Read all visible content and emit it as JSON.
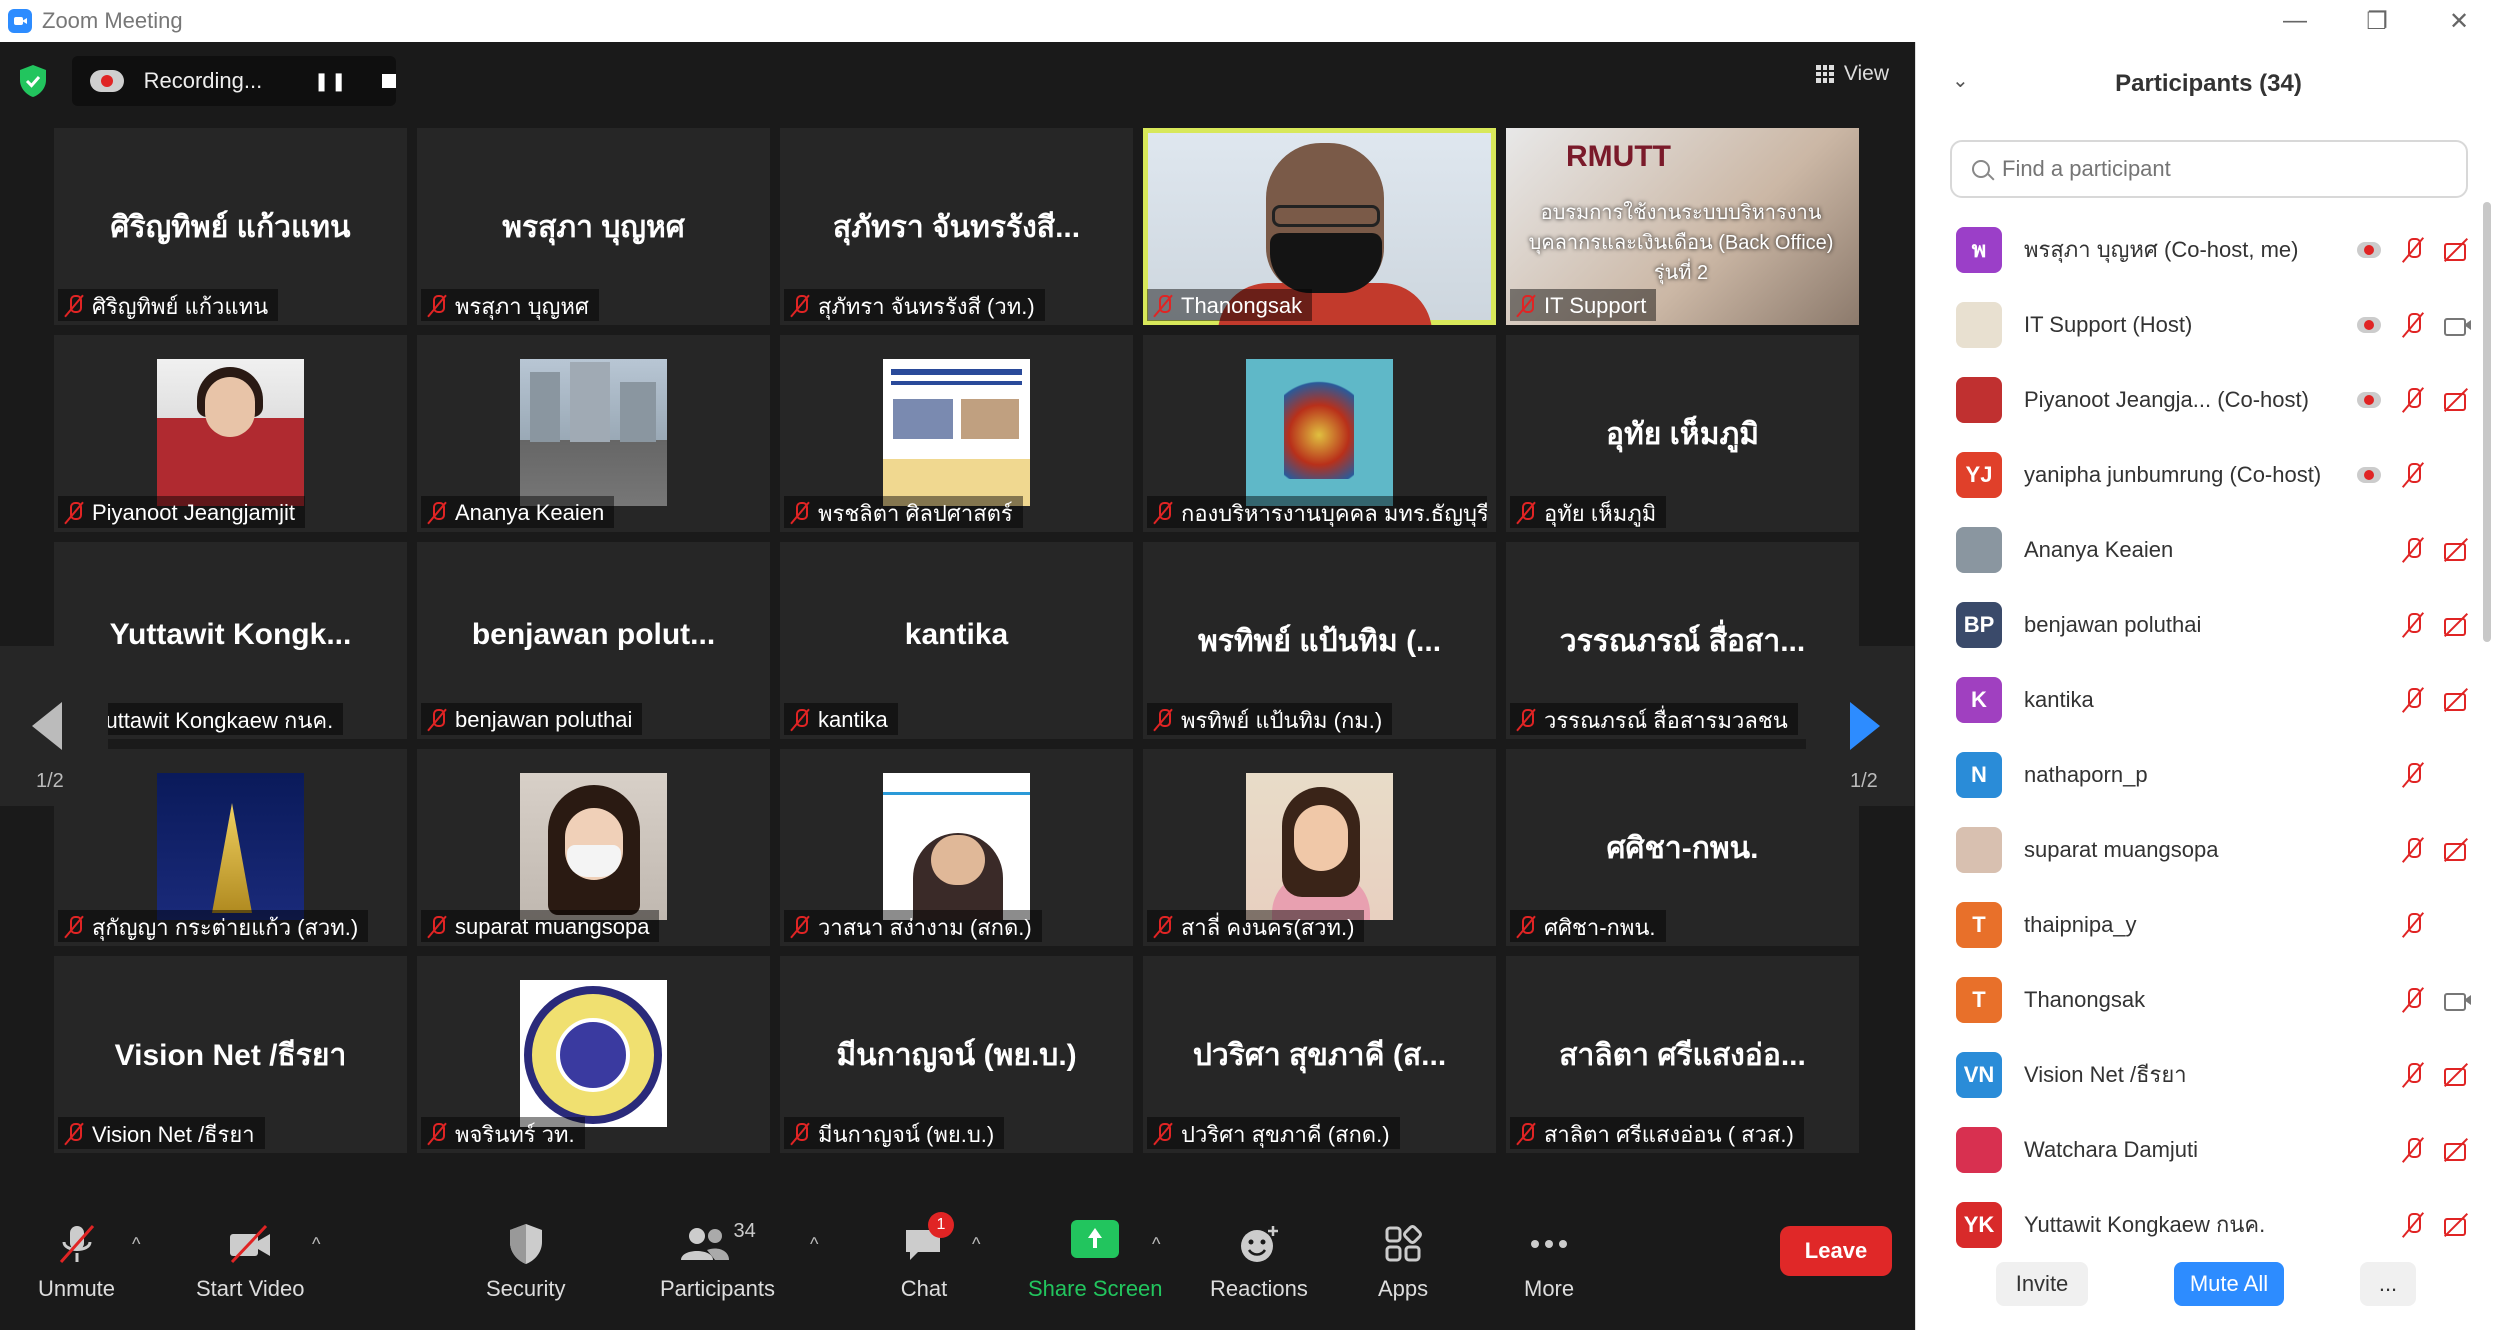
{
  "window": {
    "title": "Zoom Meeting",
    "controls": [
      "—",
      "❐",
      "✕"
    ]
  },
  "topbar": {
    "recording_label": "Recording...",
    "pause_glyph": "❚❚",
    "view_label": "View"
  },
  "tiles": [
    {
      "big": "ศิริญทิพย์ แก้วแทน",
      "label": "ศิริญทิพย์ แก้วแทน"
    },
    {
      "big": "พรสุภา บุญหศ",
      "label": "พรสุภา บุญหศ"
    },
    {
      "big": "สุภัทรา จันทรรังสี...",
      "label": "สุภัทรา จันทรรังสี (วท.)"
    },
    {
      "big": "",
      "label": "Thanongsak"
    },
    {
      "big": "",
      "label": "IT Support",
      "share_title": "RMUTT",
      "share_text": "อบรมการใช้งานระบบบริหารงานบุคลากรและเงินเดือน (Back Office) รุ่นที่ 2"
    },
    {
      "big": "",
      "label": "Piyanoot Jeangjamjit"
    },
    {
      "big": "",
      "label": "Ananya Keaien"
    },
    {
      "big": "",
      "label": "พรชลิตา ศิลปศาสตร์"
    },
    {
      "big": "",
      "label": "กองบริหารงานบุคคล มทร.ธัญบุรี"
    },
    {
      "big": "อุทัย เห็มภูมิ",
      "label": "อุทัย เห็มภูมิ"
    },
    {
      "big": "Yuttawit Kongk...",
      "label": "Yuttawit Kongkaew กนค."
    },
    {
      "big": "benjawan polut...",
      "label": "benjawan poluthai"
    },
    {
      "big": "kantika",
      "label": "kantika"
    },
    {
      "big": "พรทิพย์ แป้นทิม (...",
      "label": "พรทิพย์ แป้นทิม (กม.)"
    },
    {
      "big": "วรรณภรณ์ สื่อสา...",
      "label": "วรรณภรณ์ สื่อสารมวลชน"
    },
    {
      "big": "",
      "label": "สุกัญญา กระต่ายแก้ว (สวท.)"
    },
    {
      "big": "",
      "label": "suparat muangsopa"
    },
    {
      "big": "",
      "label": "วาสนา สง่างาม (สกด.)"
    },
    {
      "big": "",
      "label": "สาลี่ คงนคร(สวท.)"
    },
    {
      "big": "ศศิชา-กพน.",
      "label": "ศศิชา-กพน."
    },
    {
      "big": "Vision Net /ธีรยา",
      "label": "Vision Net /ธีรยา"
    },
    {
      "big": "",
      "label": "พจรินทร์ วท."
    },
    {
      "big": "มีนกาญจน์ (พย.บ.)",
      "label": "มีนกาญจน์ (พย.บ.)"
    },
    {
      "big": "ปวริศา สุขภาคี (ส...",
      "label": "ปวริศา สุขภาคี (สกด.)"
    },
    {
      "big": "สาลิตา ศรีแสงอ่อ...",
      "label": "สาลิตา ศรีแสงอ่อน ( สวส.)"
    }
  ],
  "pager": {
    "left": "1/2",
    "right": "1/2"
  },
  "toolbar": {
    "unmute": "Unmute",
    "start_video": "Start Video",
    "security": "Security",
    "participants": "Participants",
    "participants_count": "34",
    "chat": "Chat",
    "chat_badge": "1",
    "share_screen": "Share Screen",
    "reactions": "Reactions",
    "apps": "Apps",
    "more": "More",
    "leave": "Leave",
    "caret": "^"
  },
  "sidebar": {
    "title": "Participants (34)",
    "search_placeholder": "Find a participant",
    "participants": [
      {
        "avatar": "พ",
        "color": "#9b3fc8",
        "name": "พรสุภา บุญหศ (Co-host, me)",
        "rec": true,
        "cam": "off"
      },
      {
        "avatar": "",
        "color": "#e8e0d0",
        "name": "IT Support (Host)",
        "rec": true,
        "cam": "on"
      },
      {
        "avatar": "",
        "color": "#c03030",
        "name": "Piyanoot Jeangja... (Co-host)",
        "rec": true,
        "cam": "off"
      },
      {
        "avatar": "YJ",
        "color": "#e0402a",
        "name": "yanipha junbumrung (Co-host)",
        "rec": true,
        "cam": "none"
      },
      {
        "avatar": "",
        "color": "#8a96a0",
        "name": "Ananya Keaien",
        "rec": false,
        "cam": "off"
      },
      {
        "avatar": "BP",
        "color": "#3a4a6a",
        "name": "benjawan poluthai",
        "rec": false,
        "cam": "off"
      },
      {
        "avatar": "K",
        "color": "#a040c0",
        "name": "kantika",
        "rec": false,
        "cam": "off"
      },
      {
        "avatar": "N",
        "color": "#2a8cd8",
        "name": "nathaporn_p",
        "rec": false,
        "cam": "none"
      },
      {
        "avatar": "",
        "color": "#d8c0b0",
        "name": "suparat muangsopa",
        "rec": false,
        "cam": "off"
      },
      {
        "avatar": "T",
        "color": "#e8702a",
        "name": "thaipnipa_y",
        "rec": false,
        "cam": "none"
      },
      {
        "avatar": "T",
        "color": "#e8702a",
        "name": "Thanongsak",
        "rec": false,
        "cam": "on"
      },
      {
        "avatar": "VN",
        "color": "#2a8cd8",
        "name": "Vision Net /ธีรยา",
        "rec": false,
        "cam": "off"
      },
      {
        "avatar": "",
        "color": "#d83050",
        "name": "Watchara Damjuti",
        "rec": false,
        "cam": "off"
      },
      {
        "avatar": "YK",
        "color": "#d82a2a",
        "name": "Yuttawit Kongkaew กนค.",
        "rec": false,
        "cam": "off"
      }
    ],
    "invite": "Invite",
    "mute_all": "Mute All",
    "more": "..."
  }
}
